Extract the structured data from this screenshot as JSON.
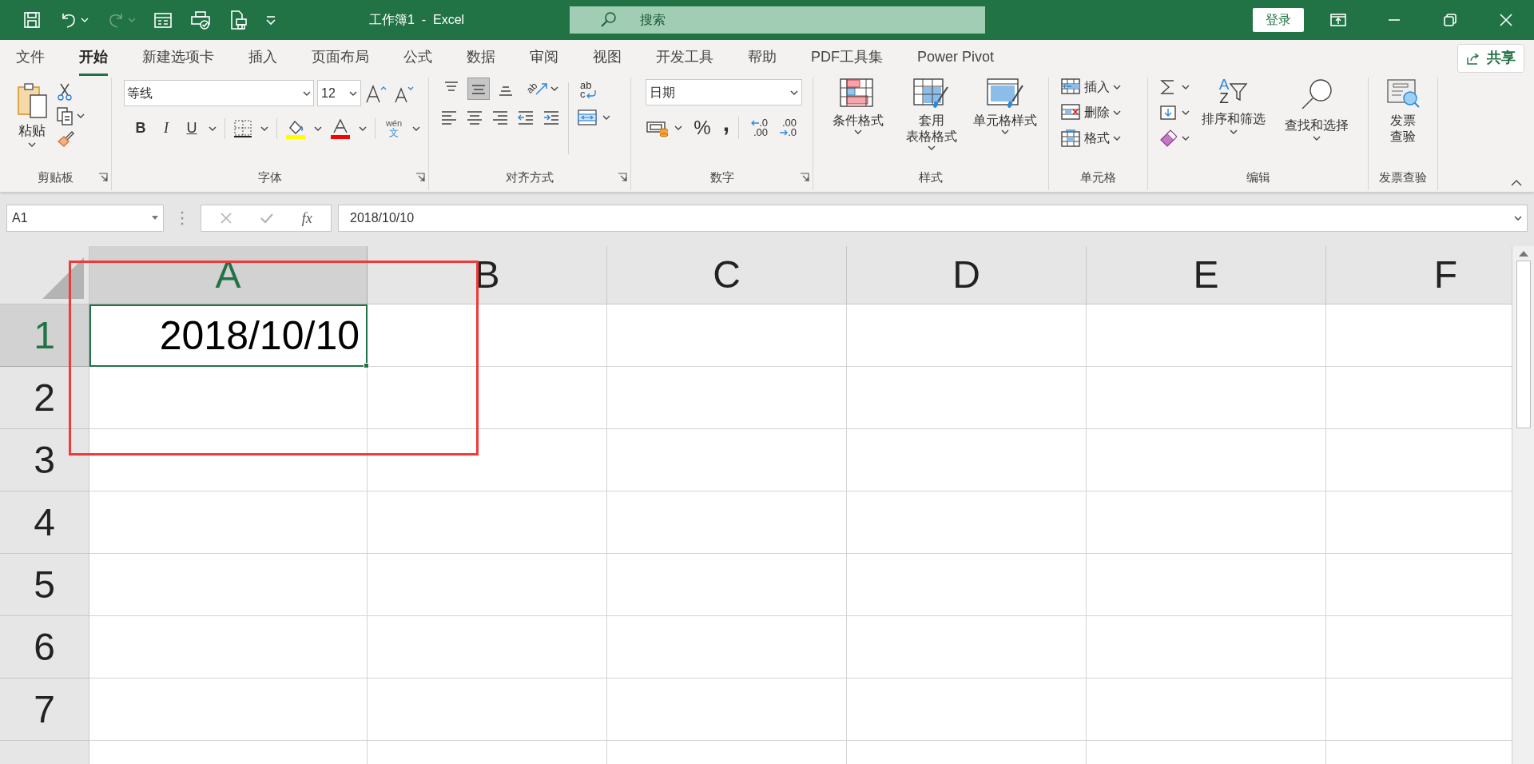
{
  "title_bar": {
    "quick_access": [
      {
        "kind": "save",
        "disabled": false
      },
      {
        "kind": "undo",
        "disabled": false
      },
      {
        "kind": "redo",
        "disabled": true
      },
      {
        "kind": "form",
        "disabled": false
      },
      {
        "kind": "print-preview",
        "disabled": false
      },
      {
        "kind": "print",
        "disabled": false
      },
      {
        "kind": "customize",
        "disabled": false
      }
    ],
    "title": "工作簿1  -  Excel",
    "search": {
      "placeholder": "搜索"
    },
    "sign_in": "登录"
  },
  "tabs": [
    {
      "label": "文件",
      "selected": false
    },
    {
      "label": "开始",
      "selected": true
    },
    {
      "label": "新建选项卡",
      "selected": false
    },
    {
      "label": "插入",
      "selected": false
    },
    {
      "label": "页面布局",
      "selected": false
    },
    {
      "label": "公式",
      "selected": false
    },
    {
      "label": "数据",
      "selected": false
    },
    {
      "label": "审阅",
      "selected": false
    },
    {
      "label": "视图",
      "selected": false
    },
    {
      "label": "开发工具",
      "selected": false
    },
    {
      "label": "帮助",
      "selected": false
    },
    {
      "label": "PDF工具集",
      "selected": false
    },
    {
      "label": "Power Pivot",
      "selected": false
    }
  ],
  "share": "共享",
  "ribbon": {
    "groups": [
      {
        "kind": "clipboard",
        "label": "剪贴板",
        "launcher": true,
        "paste": "粘贴"
      },
      {
        "kind": "font",
        "label": "字体",
        "launcher": true,
        "font_name": "等线",
        "font_size": "12",
        "bold": "B",
        "italic": "I",
        "underline": "U",
        "phonetic": [
          "wén",
          "文"
        ]
      },
      {
        "kind": "alignment",
        "label": "对齐方式",
        "launcher": true,
        "vertical_align": [
          {
            "selected": false
          },
          {
            "selected": true
          },
          {
            "selected": false
          }
        ],
        "orientation_glyph": "ab",
        "wrap_glyph": [
          "ab",
          "c"
        ]
      },
      {
        "kind": "number",
        "label": "数字",
        "launcher": true,
        "format": "日期",
        "percent": "%",
        "comma": ",",
        "increase_decimal": [
          ".0",
          ".00"
        ],
        "decrease_decimal": [
          ".00",
          ".0"
        ]
      },
      {
        "kind": "styles",
        "label": "样式",
        "launcher": false,
        "buttons": [
          {
            "kind": "conditional",
            "lines": [
              "条件格式"
            ]
          },
          {
            "kind": "table",
            "lines": [
              "套用",
              "表格格式"
            ]
          },
          {
            "kind": "cell-style",
            "lines": [
              "单元格样式"
            ]
          }
        ]
      },
      {
        "kind": "cells",
        "label": "单元格",
        "launcher": false,
        "buttons": [
          {
            "kind": "insert",
            "label": "插入"
          },
          {
            "kind": "delete",
            "label": "删除"
          },
          {
            "kind": "format",
            "label": "格式"
          }
        ]
      },
      {
        "kind": "editing",
        "label": "编辑",
        "launcher": false,
        "sort_glyph": [
          "A",
          "Z"
        ],
        "buttons": [
          {
            "kind": "sort",
            "lines": [
              "排序和筛选"
            ]
          },
          {
            "kind": "find",
            "lines": [
              "查找和选择"
            ]
          }
        ]
      },
      {
        "kind": "invoice",
        "label": "发票查验",
        "launcher": false,
        "lines": [
          "发票",
          "查验"
        ]
      }
    ]
  },
  "formula_bar": {
    "name_box": "A1",
    "function_label": "fx",
    "formula": "2018/10/10"
  },
  "sheet": {
    "columns": [
      {
        "label": "A",
        "selected": true
      },
      {
        "label": "B",
        "selected": false
      },
      {
        "label": "C",
        "selected": false
      },
      {
        "label": "D",
        "selected": false
      },
      {
        "label": "E",
        "selected": false
      },
      {
        "label": "F",
        "selected": false
      }
    ],
    "rows": [
      {
        "label": "1",
        "selected": true,
        "cells": [
          {
            "value": "2018/10/10",
            "selected": true
          }
        ]
      },
      {
        "label": "2",
        "selected": false
      },
      {
        "label": "3",
        "selected": false
      },
      {
        "label": "4",
        "selected": false
      },
      {
        "label": "5",
        "selected": false
      },
      {
        "label": "6",
        "selected": false
      },
      {
        "label": "7",
        "selected": false
      }
    ]
  },
  "highlight_frame": true
}
